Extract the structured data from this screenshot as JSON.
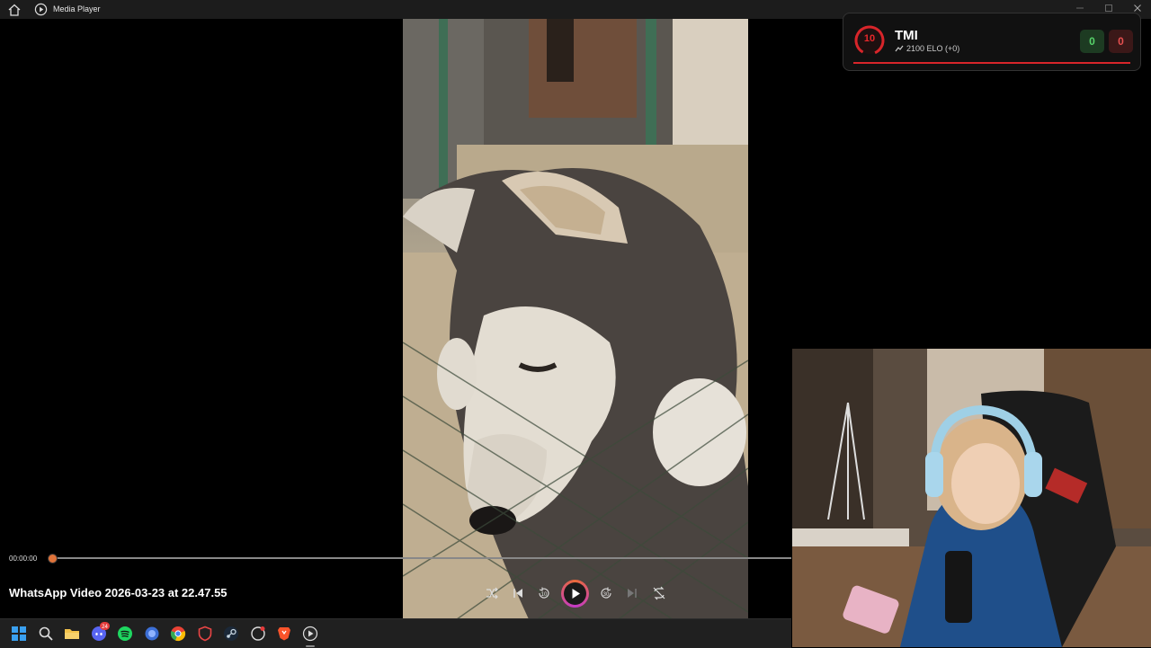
{
  "window": {
    "title": "Media Player"
  },
  "overlay": {
    "level": "10",
    "name": "TMI",
    "elo_text": "2100 ELO (+0)",
    "wins": "0",
    "losses": "0",
    "accent_color": "#d8252a"
  },
  "player": {
    "current_time": "00:00:00",
    "progress_fraction": 0,
    "video_title": "WhatsApp Video 2026-03-23 at 22.47.55",
    "controls": [
      "shuffle-icon",
      "previous-icon",
      "rewind-10-icon",
      "play-icon",
      "forward-30-icon",
      "next-icon",
      "repeat-off-icon"
    ],
    "rewind_label": "10",
    "forward_label": "30"
  },
  "taskbar": {
    "icons": [
      "windows-start-icon",
      "search-icon",
      "file-explorer-icon",
      "discord-icon",
      "spotify-icon",
      "app-icon",
      "chrome-icon",
      "security-shield-icon",
      "steam-icon",
      "app-icon-2",
      "brave-icon",
      "media-player-icon"
    ],
    "discord_badge": "24"
  }
}
